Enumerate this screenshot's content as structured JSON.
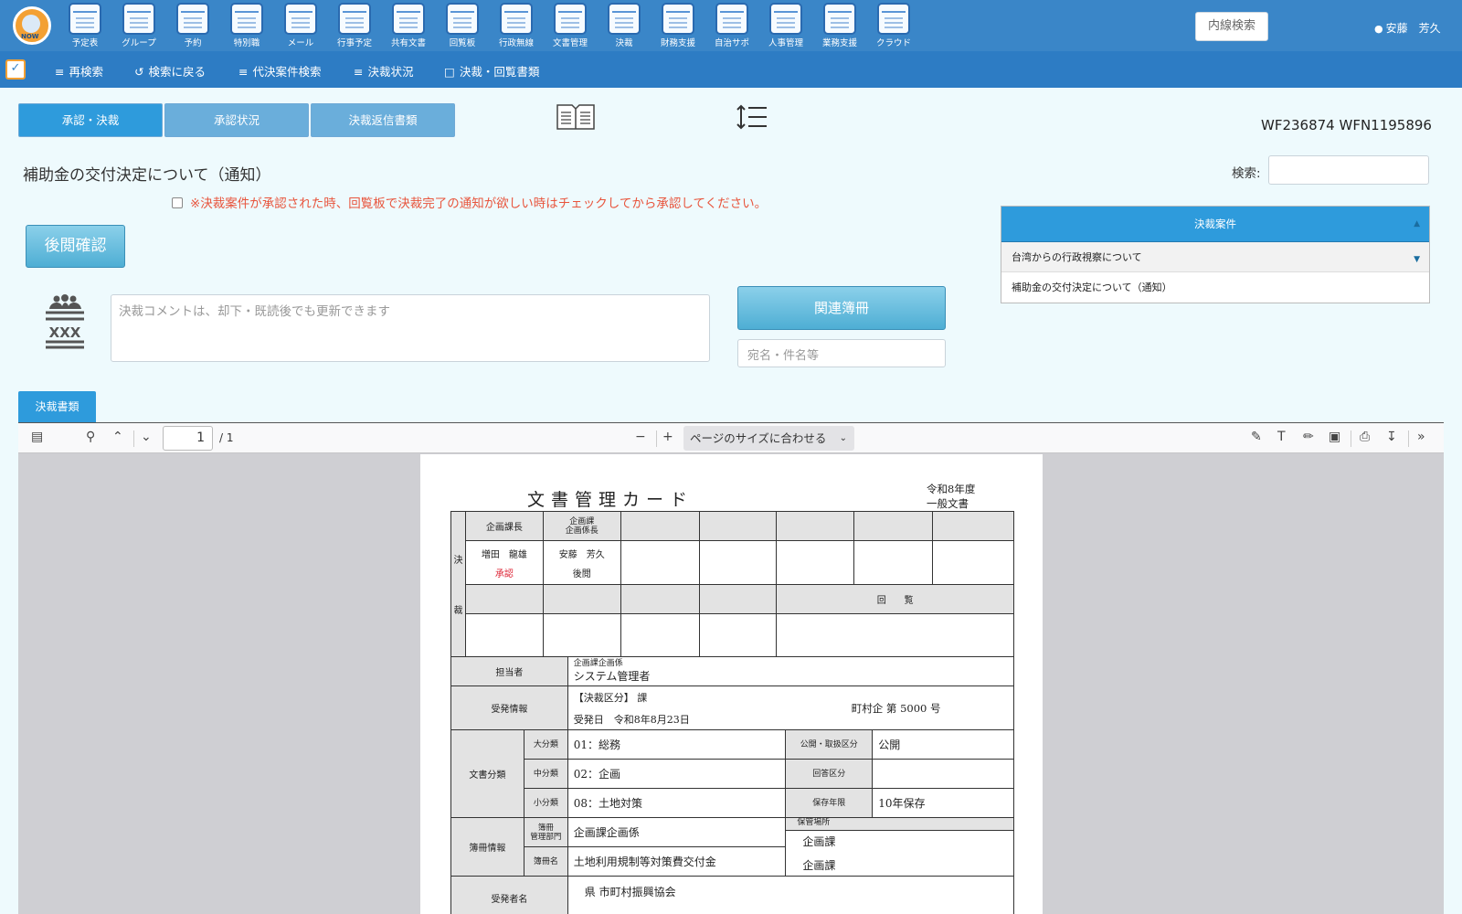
{
  "topbar": {
    "apps": [
      {
        "label": "予定表",
        "icon": "schedule-icon"
      },
      {
        "label": "グループ",
        "icon": "group-calendar-icon"
      },
      {
        "label": "予約",
        "icon": "reservation-icon"
      },
      {
        "label": "特別職",
        "icon": "special-staff-icon"
      },
      {
        "label": "メール",
        "icon": "mail-icon"
      },
      {
        "label": "行事予定",
        "icon": "event-icon"
      },
      {
        "label": "共有文書",
        "icon": "shared-docs-icon"
      },
      {
        "label": "回覧板",
        "icon": "circular-icon"
      },
      {
        "label": "行政無線",
        "icon": "radio-icon"
      },
      {
        "label": "文書管理",
        "icon": "document-management-icon"
      },
      {
        "label": "決裁",
        "icon": "approval-icon"
      },
      {
        "label": "財務支援",
        "icon": "finance-icon"
      },
      {
        "label": "自治サポ",
        "icon": "municipal-support-icon"
      },
      {
        "label": "人事管理",
        "icon": "hr-icon"
      },
      {
        "label": "業務支援",
        "icon": "business-support-icon"
      },
      {
        "label": "クラウド",
        "icon": "cloud-icon"
      }
    ],
    "logo_text": "NOW",
    "extension_search": "内線検索",
    "user": "安藤　芳久"
  },
  "subbar": {
    "items": [
      "再検索",
      "検索に戻る",
      "代決案件検索",
      "決裁状況",
      "決裁・回覧書類"
    ]
  },
  "tabs": [
    "承認・決裁",
    "承認状況",
    "決裁返信書類"
  ],
  "wf_id": "WF236874 WFN1195896",
  "doc_title": "補助金の交付決定について（通知）",
  "notify_text": "※決裁案件が承認された時、回覧板で決裁完了の通知が欲しい時はチェックしてから承認してください。",
  "post_review_button": "後閲確認",
  "comment_placeholder": "決裁コメントは、却下・既読後でも更新できます",
  "related_books_button": "関連簿冊",
  "related_search_placeholder": "宛名・件名等",
  "search_label": "検索:",
  "cases": {
    "header": "決裁案件",
    "rows": [
      "台湾からの行政視察について",
      "補助金の交付決定について（通知）"
    ]
  },
  "doc_tab": "決裁書類",
  "viewer": {
    "page": "1",
    "total": "/ 1",
    "zoom": "ページのサイズに合わせる"
  },
  "card": {
    "title": "文書管理カード",
    "fiscal_year": "令和8年度",
    "doc_type": "一般文書",
    "kessai": "決",
    "sai": "裁",
    "col1_head": "企画課長",
    "col2_head": "企画課\n企画係長",
    "col1_name": "増田　龍雄",
    "col1_status": "承認",
    "col2_name": "安藤　芳久",
    "col2_status": "後閲",
    "kairan": "回　　覧",
    "tantou_label": "担当者",
    "tantou_dept": "企画課企画係",
    "tantou_name": "システム管理者",
    "jyuhatsu_label": "受発情報",
    "jyuhatsu_line1": "【決裁区分】 課",
    "jyuhatsu_no": "町村企 第 5000 号",
    "jyuhatsu_date": "受発日　令和8年8月23日",
    "bunrui_label": "文書分類",
    "dai_label": "大分類",
    "dai_val": "01：総務",
    "chu_label": "中分類",
    "chu_val": "02：企画",
    "sho_label": "小分類",
    "sho_val": "08：土地対策",
    "koukai_label": "公開・取扱区分",
    "koukai_val": "公開",
    "kaitou_label": "回答区分",
    "kaitou_val": "",
    "hozon_label": "保存年限",
    "hozon_val": "10年保存",
    "bosatsu_label": "簿冊情報",
    "bosatsu_dept_label": "簿冊\n管理部門",
    "bosatsu_dept_val": "企画課企画係",
    "bosatsu_name_label": "簿冊名",
    "bosatsu_name_val": "土地利用規制等対策費交付金",
    "hokan_label": "保管場所",
    "hokan_val1": "企画課",
    "hokan_val2": "企画課",
    "jyuhatsusha_label": "受発者名",
    "jyuhatsusha_val": "県 市町村振興協会"
  }
}
